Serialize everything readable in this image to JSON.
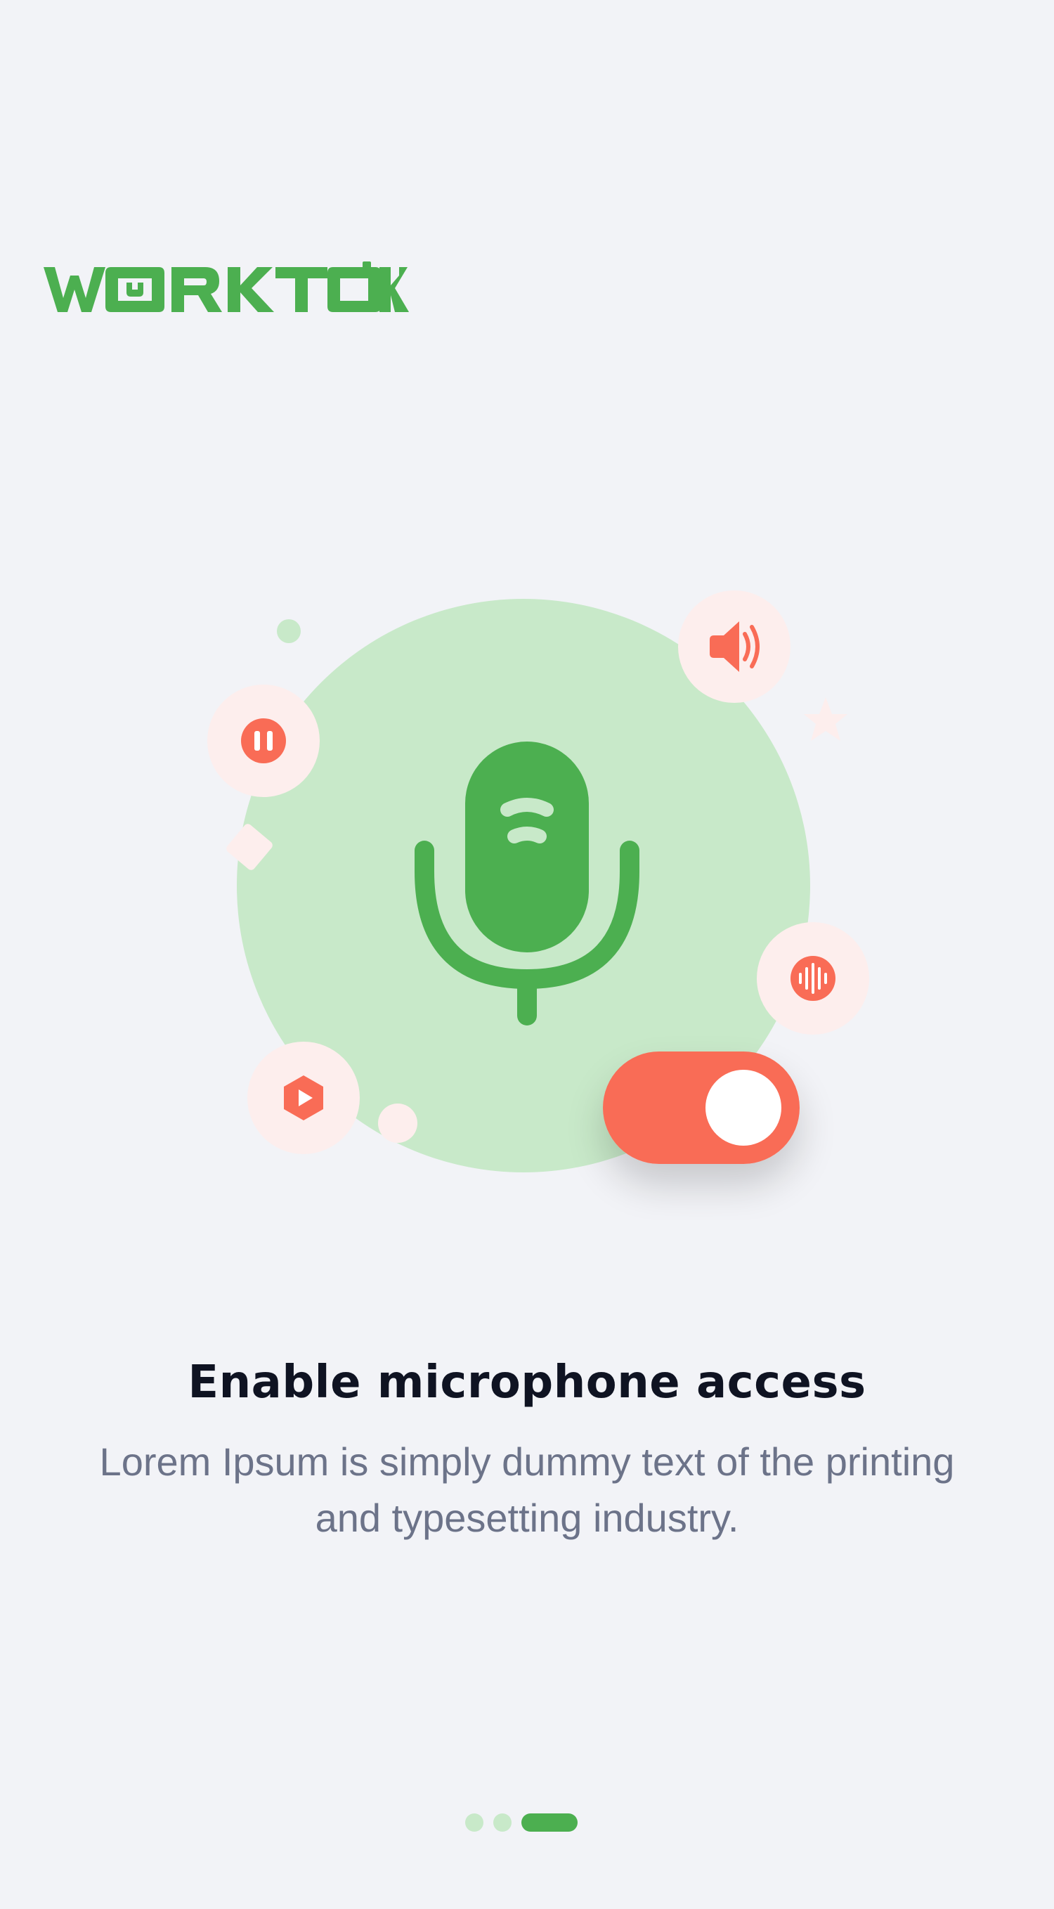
{
  "app": {
    "logo_text": "WORKTOK"
  },
  "onboarding": {
    "title": "Enable microphone access",
    "description": "Lorem Ipsum is simply dummy text of the printing and typesetting industry."
  },
  "illustration": {
    "icons": [
      "microphone-icon",
      "pause-icon",
      "speaker-icon",
      "sound-wave-icon",
      "play-icon",
      "toggle-switch"
    ],
    "toggle_state": "on"
  },
  "pager": {
    "total": 3,
    "active_index": 2
  },
  "colors": {
    "brand_green": "#4caf50",
    "light_green": "#c8e9c9",
    "accent_red": "#f96c56",
    "light_pink": "#fdeeed",
    "background": "#f2f3f7",
    "title_text": "#0f1322",
    "body_text": "#6c7389"
  }
}
